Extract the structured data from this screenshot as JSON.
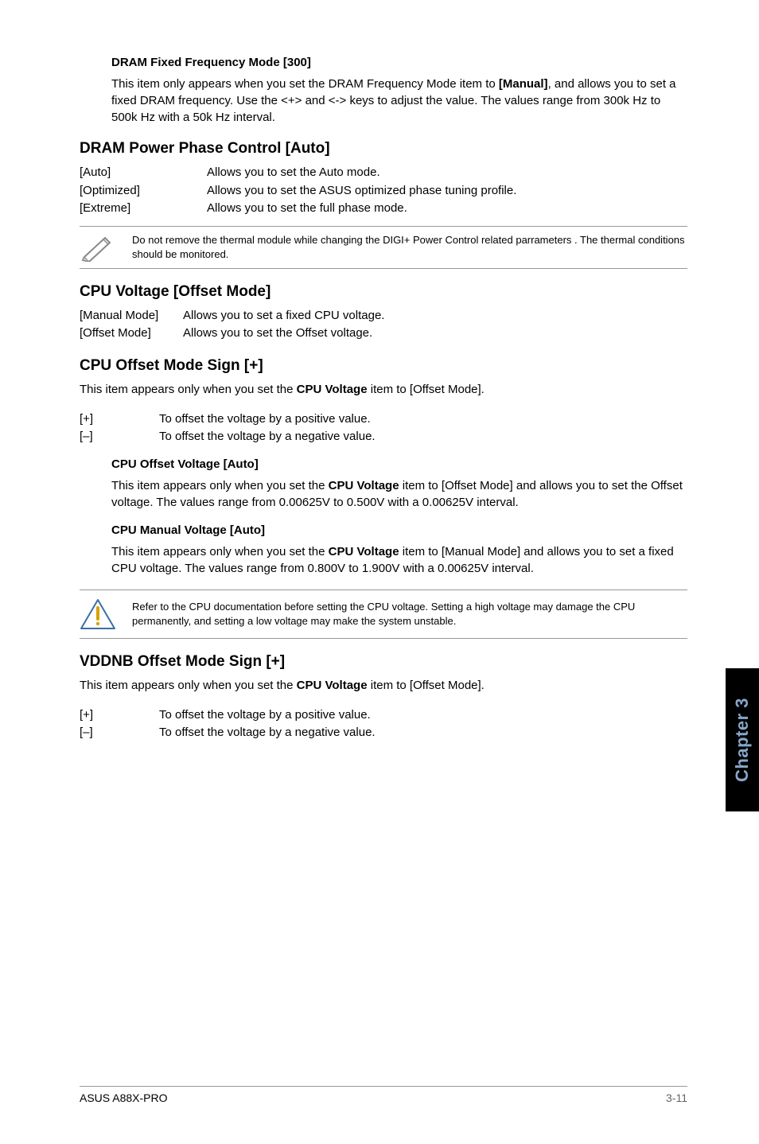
{
  "dram_fixed": {
    "title": "DRAM Fixed Frequency Mode [300]",
    "body_a": "This item only appears when you set the DRAM Frequency Mode item to ",
    "body_bold": "[Manual]",
    "body_b": ", and allows you to set a fixed DRAM frequency. Use the <+> and <-> keys to adjust the value. The values range from 300k Hz to 500k Hz with a 50k Hz interval."
  },
  "dram_power": {
    "title": "DRAM Power Phase Control [Auto]",
    "rows": [
      {
        "label": "[Auto]",
        "desc": "Allows you to set the Auto mode."
      },
      {
        "label": "[Optimized]",
        "desc": "Allows you to set the ASUS optimized phase tuning profile."
      },
      {
        "label": "[Extreme]",
        "desc": "Allows you to set the full phase mode."
      }
    ]
  },
  "note1": "Do not remove the thermal module while changing the DIGI+ Power Control related parrameters . The thermal conditions should be monitored.",
  "cpu_voltage": {
    "title": "CPU Voltage [Offset Mode]",
    "rows": [
      {
        "label": "[Manual Mode]",
        "desc": "Allows you to set a fixed CPU voltage."
      },
      {
        "label": "[Offset Mode]",
        "desc": "Allows you to set the Offset voltage."
      }
    ]
  },
  "cpu_offset_sign": {
    "title": "CPU Offset Mode Sign [+]",
    "intro_a": "This item appears only when you set the ",
    "intro_bold": "CPU Voltage",
    "intro_b": " item to [Offset Mode].",
    "rows": [
      {
        "label": "[+]",
        "desc": "To offset the voltage by a positive value."
      },
      {
        "label": "[–]",
        "desc": "To offset the voltage by a negative value."
      }
    ]
  },
  "cpu_offset_voltage": {
    "title": "CPU Offset Voltage [Auto]",
    "body_a": "This item appears only when you set the ",
    "body_bold": "CPU Voltage",
    "body_b": " item to [Offset Mode] and allows you to set the Offset voltage. The values range from 0.00625V to 0.500V with a 0.00625V interval."
  },
  "cpu_manual_voltage": {
    "title": "CPU Manual Voltage [Auto]",
    "body_a": "This item appears only when you set the ",
    "body_bold": "CPU Voltage",
    "body_b": " item to [Manual Mode] and allows you to set a fixed CPU voltage. The values range from 0.800V to 1.900V with a 0.00625V interval."
  },
  "warn": "Refer to the CPU documentation before setting the CPU voltage. Setting a high voltage may damage the CPU permanently, and setting a low voltage may make the system unstable.",
  "vddnb": {
    "title": "VDDNB Offset Mode Sign [+]",
    "intro_a": "This item appears only when you set the ",
    "intro_bold": "CPU Voltage",
    "intro_b": " item to [Offset Mode].",
    "rows": [
      {
        "label": "[+]",
        "desc": "To offset the voltage by a positive value."
      },
      {
        "label": "[–]",
        "desc": "To offset the voltage by a negative value."
      }
    ]
  },
  "side_tab": "Chapter 3",
  "footer": {
    "left": "ASUS A88X-PRO",
    "right": "3-11"
  }
}
